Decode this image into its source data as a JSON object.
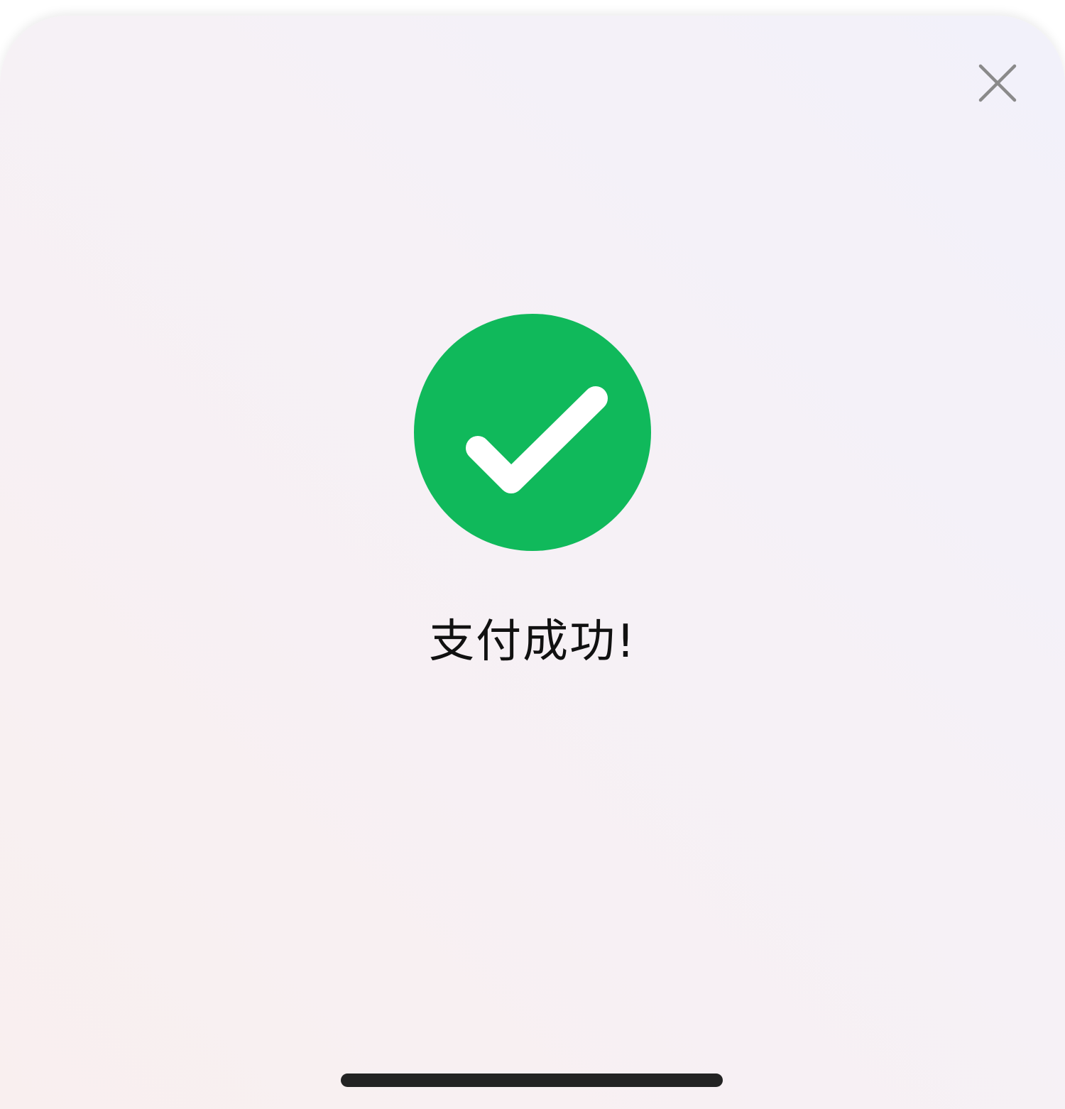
{
  "dialog": {
    "close_icon": "close-icon",
    "status_icon": "check-circle-icon",
    "status_color": "#10b95b",
    "message": "支付成功!"
  },
  "system": {
    "home_indicator": "home-indicator"
  }
}
